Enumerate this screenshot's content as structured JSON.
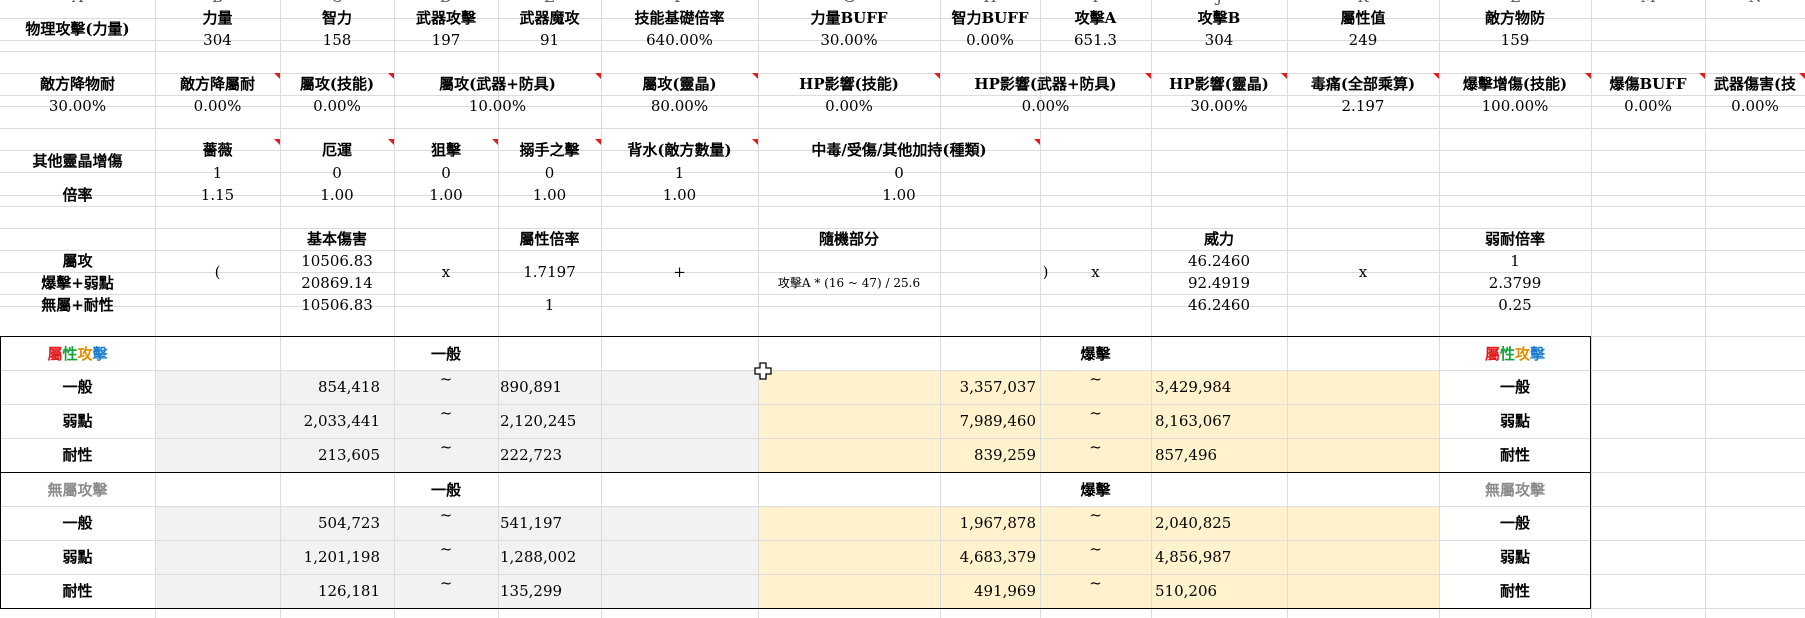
{
  "colors": {
    "gray": "#f2f2f2",
    "yellow": "#fff2cc",
    "red": "#e21b1b",
    "green": "#18a03a",
    "orange": "#e38d00",
    "blue": "#1e7fd0",
    "muted": "#8c8c8c"
  },
  "column_letters": [
    "A",
    "B",
    "C",
    "D",
    "E",
    "F",
    "G",
    "H",
    "I",
    "J",
    "K",
    "L",
    "M",
    "N"
  ],
  "block1": {
    "label": "物理攻擊(力量)",
    "headers": [
      "力量",
      "智力",
      "武器攻擊",
      "武器魔攻",
      "技能基礎倍率",
      "力量BUFF",
      "智力BUFF",
      "攻擊A",
      "攻擊B",
      "屬性值",
      "敵方物防"
    ],
    "values": [
      "304",
      "158",
      "197",
      "91",
      "640.00%",
      "30.00%",
      "0.00%",
      "651.3",
      "304",
      "249",
      "159"
    ]
  },
  "block2": {
    "headers": [
      "敵方降物耐",
      "敵方降屬耐",
      "屬攻(技能)",
      "屬攻(武器+防具)",
      "屬攻(靈晶)",
      "HP影響(技能)",
      "HP影響(武器+防具)",
      "HP影響(靈晶)",
      "毒痛(全部乘算)",
      "爆擊增傷(技能)",
      "爆傷BUFF",
      "武器傷害(技"
    ],
    "values": [
      "30.00%",
      "0.00%",
      "0.00%",
      "10.00%",
      "80.00%",
      "0.00%",
      "0.00%",
      "30.00%",
      "2.197",
      "100.00%",
      "0.00%",
      "0.00%"
    ]
  },
  "block3": {
    "label": "其他靈晶增傷",
    "rate_label": "倍率",
    "headers": [
      "薔薇",
      "厄運",
      "狙擊",
      "搦手之擊",
      "背水(敵方數量)",
      "中毒/受傷/其他加持(種類)"
    ],
    "values": [
      "1",
      "0",
      "0",
      "0",
      "1",
      "0"
    ],
    "rates": [
      "1.15",
      "1.00",
      "1.00",
      "1.00",
      "1.00",
      "1.00"
    ]
  },
  "formula": {
    "row_labels": [
      "屬攻",
      "爆擊+弱點",
      "無屬+耐性"
    ],
    "open_paren": "(",
    "base_header": "基本傷害",
    "base_values": [
      "10506.83",
      "20869.14",
      "10506.83"
    ],
    "times1": "x",
    "attr_header": "屬性倍率",
    "attr_values": [
      "1.7197",
      "1"
    ],
    "plus": "+",
    "random_header": "隨機部分",
    "random_formula": "攻擊A * (16 ~ 47) / 25.6",
    "close_paren": ")",
    "times2": "x",
    "power_header": "威力",
    "power_values": [
      "46.2460",
      "92.4919",
      "46.2460"
    ],
    "times3": "x",
    "weak_header": "弱耐倍率",
    "weak_values": [
      "1",
      "2.3799",
      "0.25"
    ]
  },
  "results": [
    {
      "title_parts": [
        "屬",
        "性",
        "攻",
        "擊"
      ],
      "normal_header": "一般",
      "crit_header": "爆擊",
      "tilde": "~",
      "rows": [
        {
          "label": "一般",
          "normal_min": "854,418",
          "normal_max": "890,891",
          "crit_min": "3,357,037",
          "crit_max": "3,429,984"
        },
        {
          "label": "弱點",
          "normal_min": "2,033,441",
          "normal_max": "2,120,245",
          "crit_min": "7,989,460",
          "crit_max": "8,163,067"
        },
        {
          "label": "耐性",
          "normal_min": "213,605",
          "normal_max": "222,723",
          "crit_min": "839,259",
          "crit_max": "857,496"
        }
      ]
    },
    {
      "title": "無屬攻擊",
      "normal_header": "一般",
      "crit_header": "爆擊",
      "tilde": "~",
      "rows": [
        {
          "label": "一般",
          "normal_min": "504,723",
          "normal_max": "541,197",
          "crit_min": "1,967,878",
          "crit_max": "2,040,825"
        },
        {
          "label": "弱點",
          "normal_min": "1,201,198",
          "normal_max": "1,288,002",
          "crit_min": "4,683,379",
          "crit_max": "4,856,987"
        },
        {
          "label": "耐性",
          "normal_min": "126,181",
          "normal_max": "135,299",
          "crit_min": "491,969",
          "crit_max": "510,206"
        }
      ]
    }
  ]
}
